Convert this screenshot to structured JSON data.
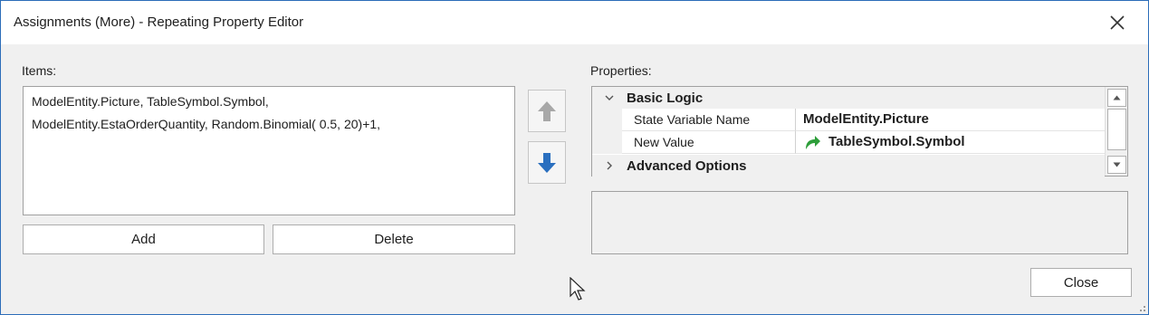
{
  "window": {
    "title": "Assignments (More) - Repeating Property Editor"
  },
  "items": {
    "label": "Items:",
    "lines": [
      "ModelEntity.Picture, TableSymbol.Symbol,",
      "ModelEntity.EstaOrderQuantity, Random.Binomial( 0.5, 20)+1,"
    ],
    "add_label": "Add",
    "delete_label": "Delete"
  },
  "properties": {
    "label": "Properties:",
    "categories": [
      {
        "name": "Basic Logic",
        "expanded": true,
        "rows": [
          {
            "name": "State Variable Name",
            "value": "ModelEntity.Picture"
          },
          {
            "name": "New Value",
            "value": "TableSymbol.Symbol"
          }
        ]
      },
      {
        "name": "Advanced Options",
        "expanded": false
      }
    ]
  },
  "footer": {
    "close_label": "Close"
  },
  "icons": {
    "move_up": "arrow-up-icon",
    "move_down": "arrow-down-icon",
    "referenced_value": "curved-arrow-icon"
  },
  "colors": {
    "accent_blue": "#2b6cb8",
    "green_arrow": "#2e9e3a"
  }
}
